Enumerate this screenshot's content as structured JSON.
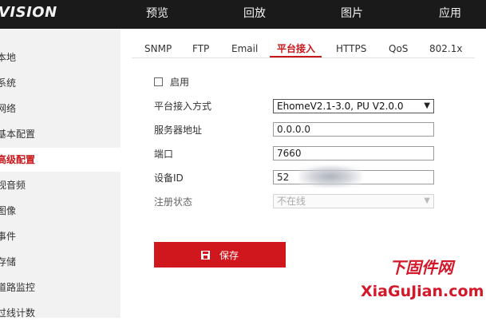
{
  "brand": {
    "text": "VISION"
  },
  "top_nav": [
    {
      "label": "预览"
    },
    {
      "label": "回放"
    },
    {
      "label": "图片"
    },
    {
      "label": "应用"
    }
  ],
  "sidebar": {
    "items": [
      {
        "label": "本地"
      },
      {
        "label": "系统"
      },
      {
        "label": "网络"
      },
      {
        "label": "基本配置"
      },
      {
        "label": "高级配置",
        "active": true
      },
      {
        "label": "视音频"
      },
      {
        "label": "图像"
      },
      {
        "label": "事件"
      },
      {
        "label": "存储"
      },
      {
        "label": "道路监控"
      },
      {
        "label": "过线计数"
      }
    ]
  },
  "tabs": [
    {
      "label": "SNMP"
    },
    {
      "label": "FTP"
    },
    {
      "label": "Email"
    },
    {
      "label": "平台接入",
      "active": true
    },
    {
      "label": "HTTPS"
    },
    {
      "label": "QoS"
    },
    {
      "label": "802.1x"
    }
  ],
  "form": {
    "enable_label": "启用",
    "enable_checked": false,
    "mode_label": "平台接入方式",
    "mode_value": "EhomeV2.1-3.0, PU V2.0.0",
    "server_label": "服务器地址",
    "server_value": "0.0.0.0",
    "port_label": "端口",
    "port_value": "7660",
    "device_id_label": "设备ID",
    "device_id_value": "52",
    "reg_status_label": "注册状态",
    "reg_status_value": "不在线"
  },
  "save_button": {
    "label": "保存"
  },
  "watermark": {
    "line1": "下固件网",
    "line2": "XiaGuJian.com"
  },
  "colors": {
    "accent": "#c8171b",
    "topbar": "#1a1a1a",
    "sidebar": "#f2f2f2"
  }
}
